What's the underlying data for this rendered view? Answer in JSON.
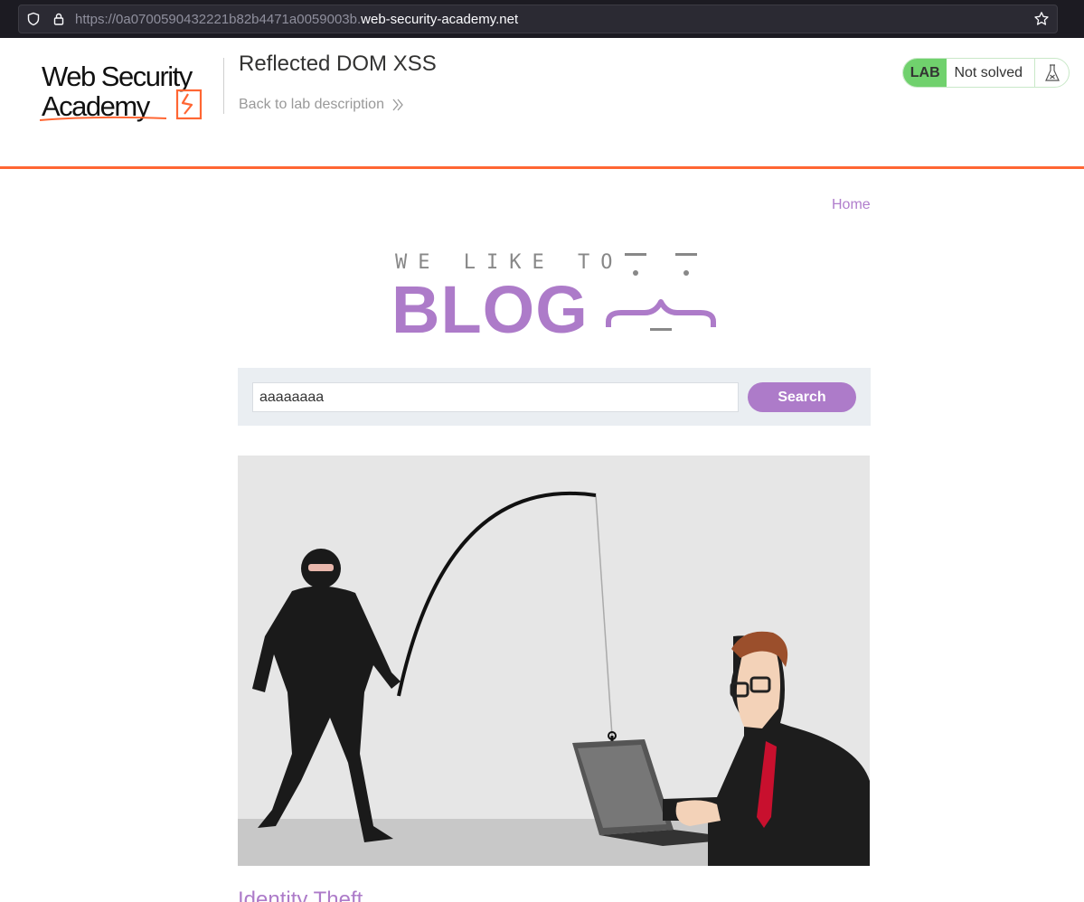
{
  "browser": {
    "url_prefix": "https://0a0700590432221b82b4471a0059003b.",
    "url_domain": "web-security-academy.net"
  },
  "academy": {
    "logo_line1": "Web Security",
    "logo_line2": "Academy",
    "lab_title": "Reflected DOM XSS",
    "back_link": "Back to lab description",
    "lab_tag": "LAB",
    "status": "Not solved",
    "accent_color": "#ff6633",
    "status_color": "#70d16d"
  },
  "blog": {
    "nav_home": "Home",
    "logo_top": "WE LIKE TO",
    "logo_main": "BLOG",
    "brand_color": "#ad7bc9",
    "search": {
      "value": "aaaaaaaa",
      "button": "Search"
    },
    "post": {
      "image_alt": "phishing illustration",
      "title": "Identity Theft"
    }
  }
}
